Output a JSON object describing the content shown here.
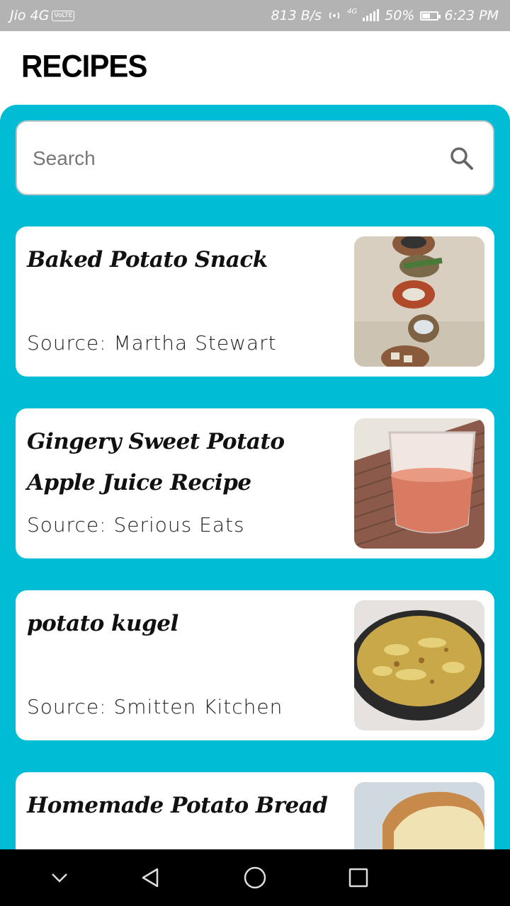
{
  "status_bar": {
    "carrier": "Jio 4G",
    "volte": "VoLTE",
    "speed": "813 B/s",
    "network_type": "4G",
    "battery": "50%",
    "battery_level": 0.5,
    "time": "6:23 PM"
  },
  "header": {
    "title": "RECIPES"
  },
  "search": {
    "placeholder": "Search",
    "value": "",
    "icon": "search-icon"
  },
  "colors": {
    "accent": "#00bcd4",
    "card": "#ffffff",
    "status_bar": "#b3b3b3"
  },
  "recipes": [
    {
      "title": "Baked Potato Snack",
      "source": "Source: Martha Stewart"
    },
    {
      "title": "Gingery Sweet Potato Apple Juice Recipe",
      "source": "Source: Serious Eats"
    },
    {
      "title": "potato kugel",
      "source": "Source: Smitten Kitchen"
    },
    {
      "title": "Homemade Potato Bread",
      "source": ""
    }
  ],
  "nav": {
    "back_icon": "back-icon",
    "home_icon": "home-icon",
    "recents_icon": "recents-icon",
    "hide_icon": "chevron-down-icon"
  }
}
